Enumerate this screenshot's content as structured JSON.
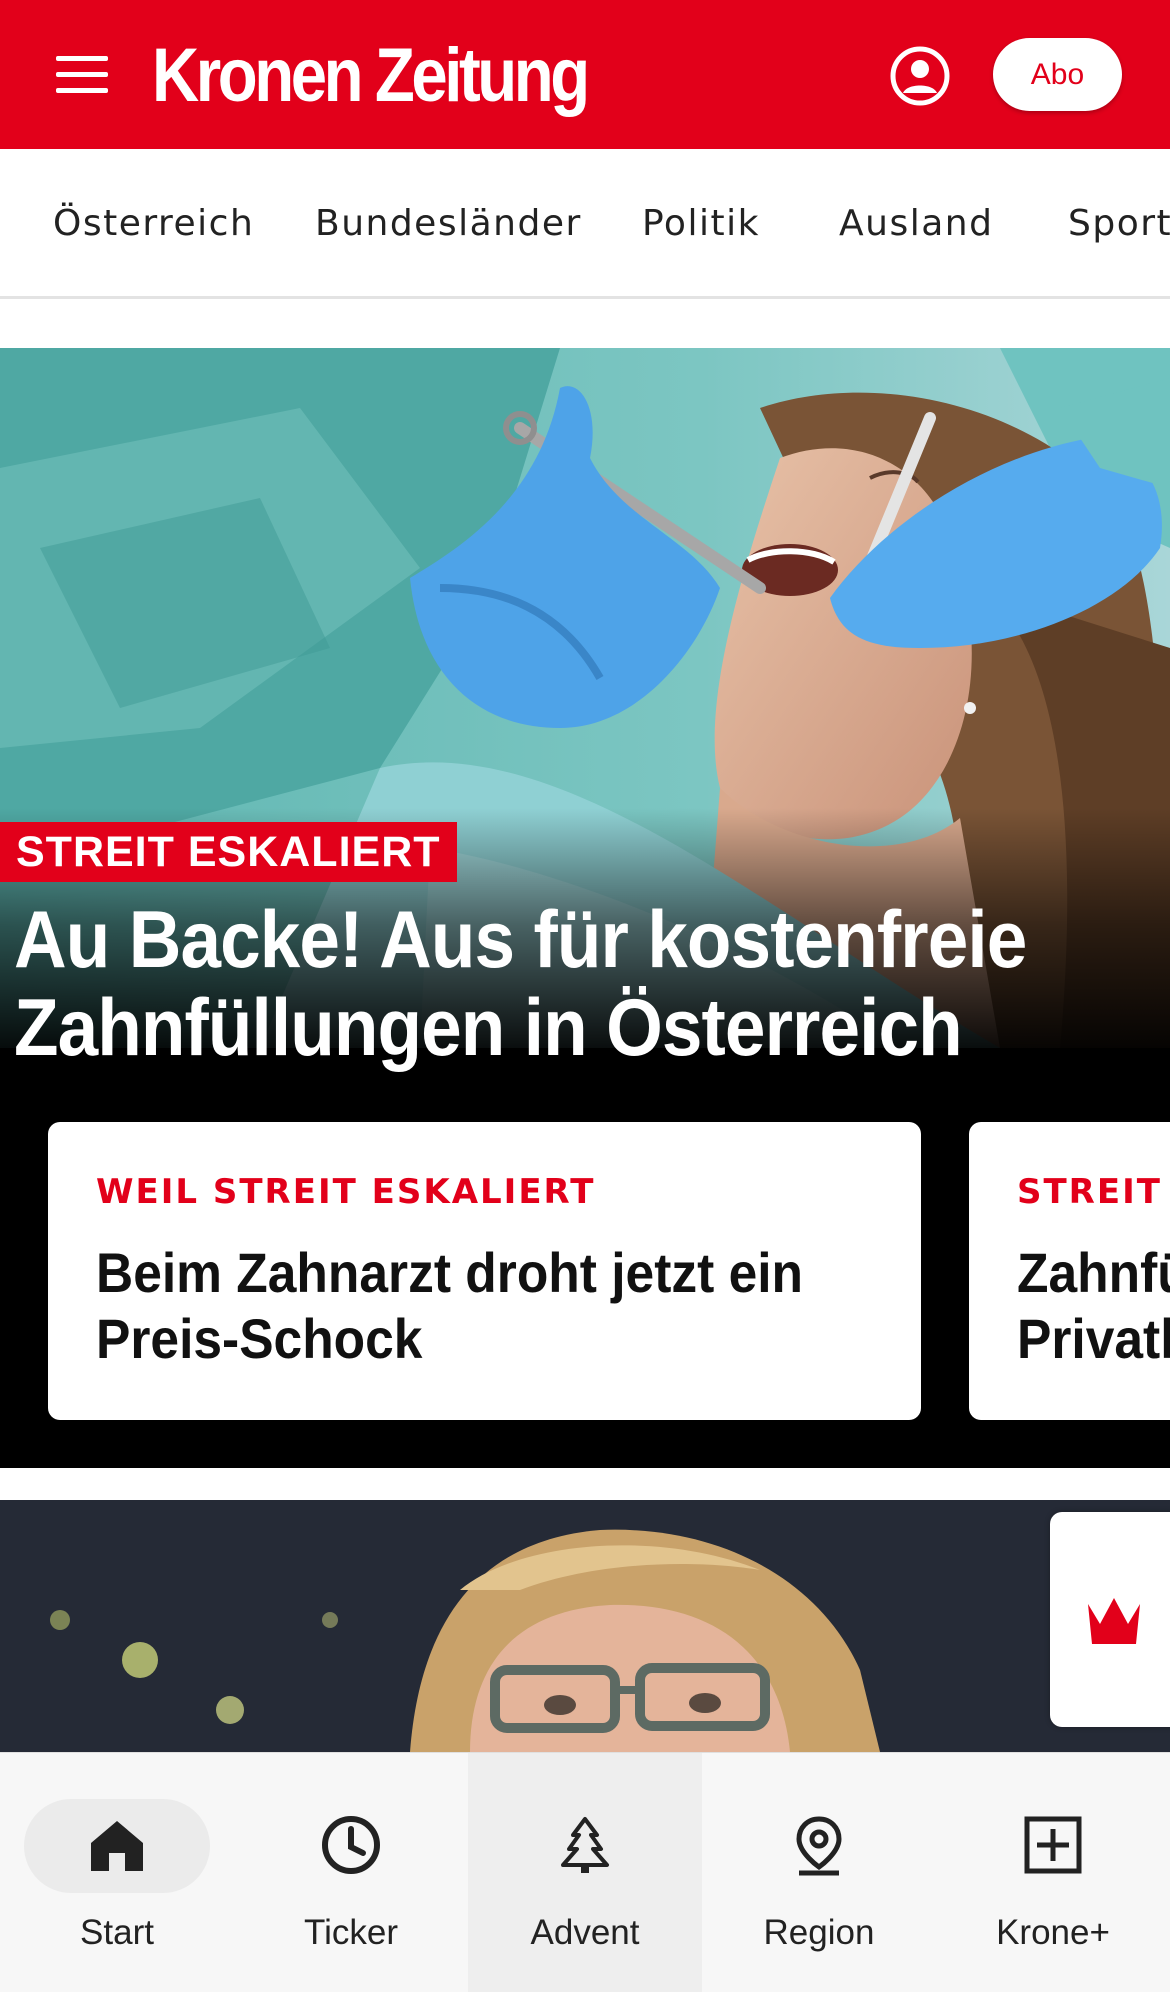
{
  "header": {
    "logo": "Kronen Zeitung",
    "abo_label": "Abo",
    "brand_color": "#e2001a"
  },
  "categories": [
    "Österreich",
    "Bundesländer",
    "Politik",
    "Ausland",
    "Sport"
  ],
  "hero": {
    "kicker": "STREIT ESKALIERT",
    "title_line1": "Au Backe! Aus für kostenfreie",
    "title_line2": "Zahnfüllungen in Österreich"
  },
  "related": [
    {
      "kicker": "WEIL STREIT ESKALIERT",
      "title_line1": "Beim Zahnarzt droht jetzt ein",
      "title_line2": "Preis-Schock"
    },
    {
      "kicker": "STREIT U",
      "title_line1": "Zahnfü",
      "title_line2": "Privatl"
    }
  ],
  "bottom_nav": {
    "items": [
      {
        "label": "Start",
        "icon": "home-icon"
      },
      {
        "label": "Ticker",
        "icon": "clock-icon"
      },
      {
        "label": "Advent",
        "icon": "tree-icon"
      },
      {
        "label": "Region",
        "icon": "location-pin-icon"
      },
      {
        "label": "Krone+",
        "icon": "plus-box-icon"
      }
    ]
  }
}
